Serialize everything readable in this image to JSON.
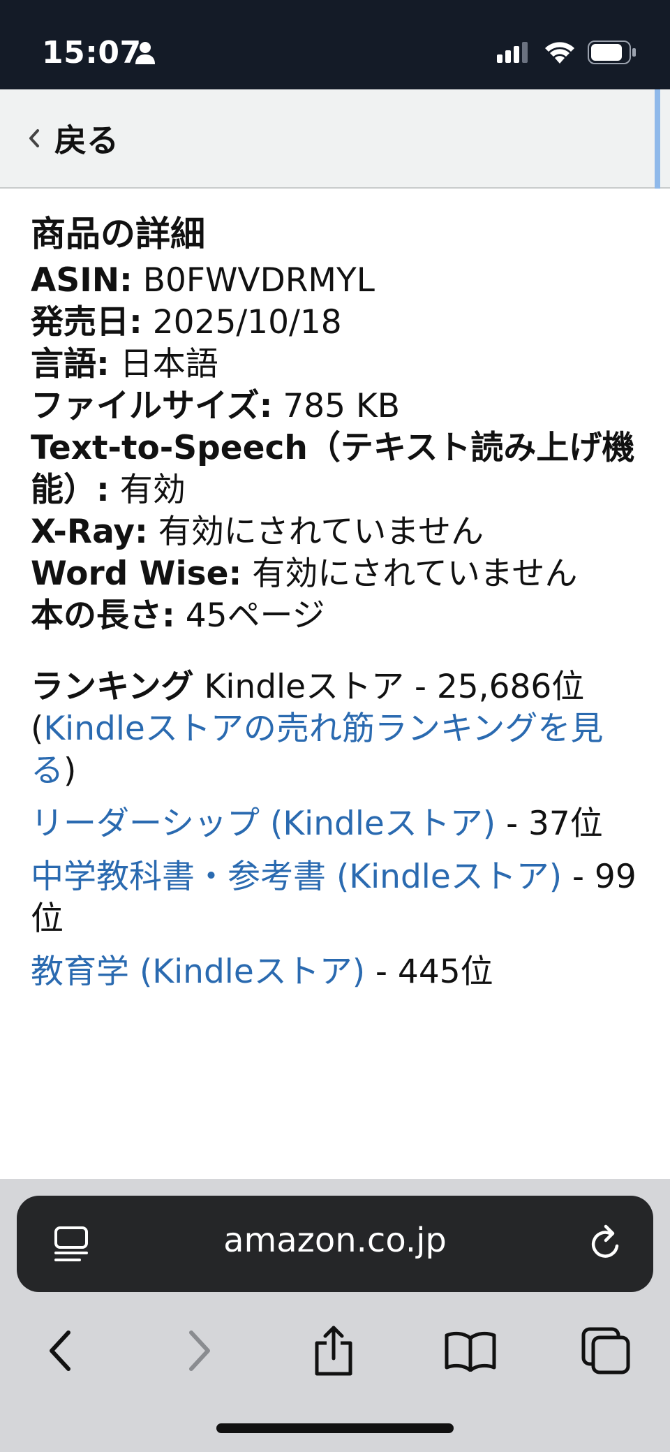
{
  "status_bar": {
    "time": "15:07",
    "icons": [
      "person-icon",
      "signal-icon",
      "wifi-icon",
      "battery-icon"
    ]
  },
  "nav": {
    "back_label": "戻る"
  },
  "details": {
    "title": "商品の詳細",
    "lines": [
      {
        "label": "ASIN:",
        "value": " B0FWVDRMYL"
      },
      {
        "label": "発売日:",
        "value": " 2025/10/18"
      },
      {
        "label": "言語:",
        "value": " 日本語"
      },
      {
        "label": "ファイルサイズ:",
        "value": " 785 KB"
      },
      {
        "label": "Text-to-Speech（テキスト読み上げ機能）:",
        "value": " 有効"
      },
      {
        "label": "X-Ray:",
        "value": " 有効にされていません"
      },
      {
        "label": "Word Wise:",
        "value": " 有効にされていません"
      },
      {
        "label": "本の長さ:",
        "value": " 45ページ"
      }
    ]
  },
  "ranking": {
    "label": "ランキング",
    "main_text": " Kindleストア - 25,686位",
    "open_paren": "(",
    "bestseller_link": "Kindleストアの売れ筋ランキングを見る",
    "close_paren": ")",
    "categories": [
      {
        "link": "リーダーシップ (Kindleストア)",
        "rank": "  - 37位"
      },
      {
        "link": "中学教科書・参考書 (Kindleストア)",
        "rank": " - 99位"
      },
      {
        "link": "教育学 (Kindleストア)",
        "rank": " - 445位"
      }
    ]
  },
  "browser": {
    "url": "amazon.co.jp"
  },
  "colors": {
    "link": "#2a6ab0",
    "status_bar_bg": "#141b27",
    "nav_bg": "#f0f2f2"
  }
}
